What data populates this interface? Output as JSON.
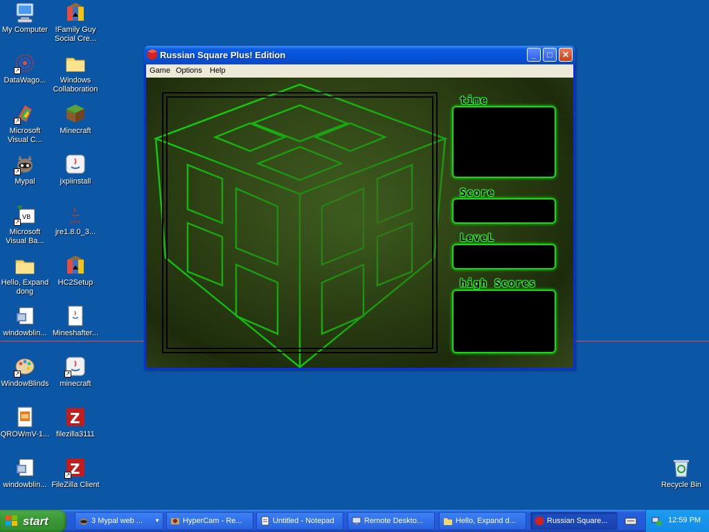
{
  "desktop": {
    "icons": [
      {
        "label": "My Computer"
      },
      {
        "label": "!Family Guy Social Cre..."
      },
      {
        "label": "DataWago..."
      },
      {
        "label": "Windows Collaboration"
      },
      {
        "label": "Microsoft Visual C..."
      },
      {
        "label": "Minecraft"
      },
      {
        "label": "Mypal"
      },
      {
        "label": "jxpiinstall"
      },
      {
        "label": "Microsoft Visual Ba..."
      },
      {
        "label": "jre1.8.0_3..."
      },
      {
        "label": "Hello, Expand dong"
      },
      {
        "label": "HC2Setup"
      },
      {
        "label": "windowblin..."
      },
      {
        "label": "Mineshafter..."
      },
      {
        "label": "WindowBlinds"
      },
      {
        "label": "minecraft"
      },
      {
        "label": "QROWmV-1..."
      },
      {
        "label": "filezilla3111"
      },
      {
        "label": "windowblin..."
      },
      {
        "label": "FileZilla Client"
      },
      {
        "label": "Recycle Bin"
      }
    ]
  },
  "window": {
    "title": "Russian Square Plus! Edition",
    "menu": [
      "Game",
      "Options",
      "Help"
    ],
    "panels": {
      "time_label": "time",
      "score_label": "Score",
      "level_label": "LeveL",
      "highscores_label": "high Scores"
    }
  },
  "taskbar": {
    "start_label": "start",
    "tasks": [
      {
        "label": "3 Mypal web ..."
      },
      {
        "label": "HyperCam - Re..."
      },
      {
        "label": "Untitled - Notepad"
      },
      {
        "label": "Remote Deskto..."
      },
      {
        "label": "Hello, Expand d..."
      },
      {
        "label": "Russian Square..."
      }
    ],
    "clock": "12:59 PM"
  },
  "colors": {
    "desktop": "#0c56a6",
    "neon_green": "#1fd21f",
    "titlebar": "#0552d8"
  }
}
